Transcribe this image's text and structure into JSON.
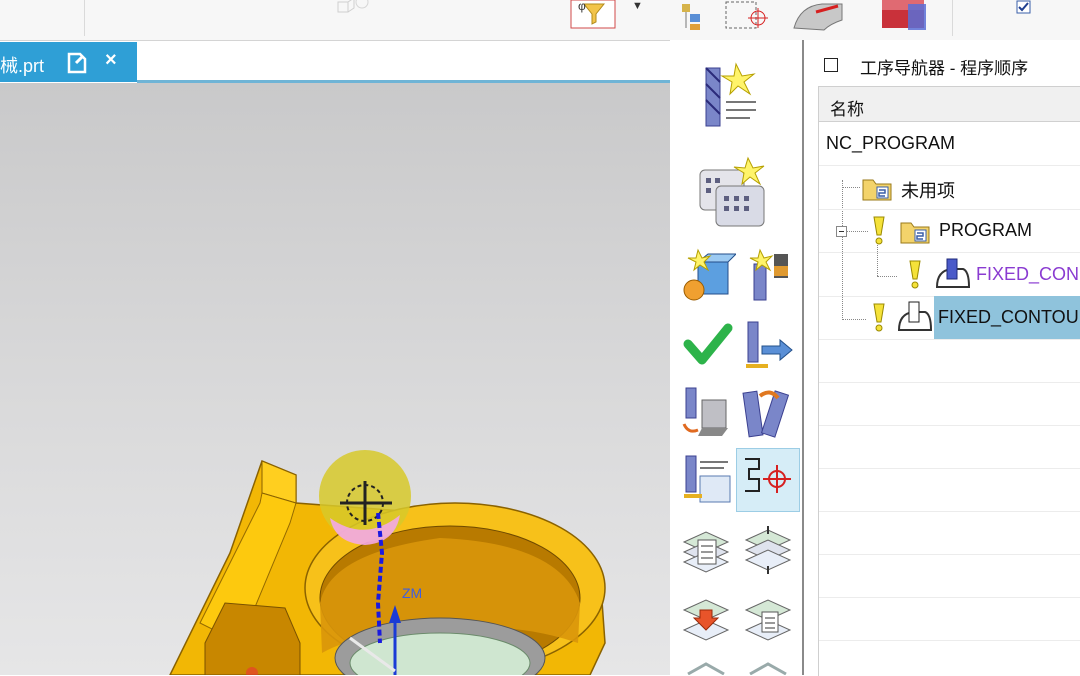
{
  "file_tab": {
    "name": "械.prt",
    "close_glyph": "×"
  },
  "navigator": {
    "title": "工序导航器 - 程序顺序",
    "column_header": "名称",
    "rows": [
      {
        "label": "NC_PROGRAM"
      },
      {
        "label": "未用项"
      },
      {
        "label": "PROGRAM"
      },
      {
        "label": "FIXED_CON"
      },
      {
        "label": "FIXED_CONTOU"
      }
    ]
  },
  "viewport": {
    "axis_label": "ZM",
    "part_color": "#f2b705"
  },
  "colors": {
    "tab_blue": "#2f9fd6",
    "selection_blue": "#8fc3dc",
    "purple_text": "#8a3bd1",
    "warning_yellow": "#f5e23a"
  },
  "icons": {
    "toolbar": [
      "create-tool-icon",
      "create-geometry-icon",
      "create-method-icon",
      "create-program-icon",
      "verify-check-icon",
      "output-toolpath-icon",
      "machine-simulate-icon",
      "tool-reorder-icon",
      "list-tool-icon",
      "coordinate-system-icon",
      "layer-list-icon",
      "layer-stack-icon",
      "layer-insert-icon",
      "layer-copy-icon"
    ]
  }
}
